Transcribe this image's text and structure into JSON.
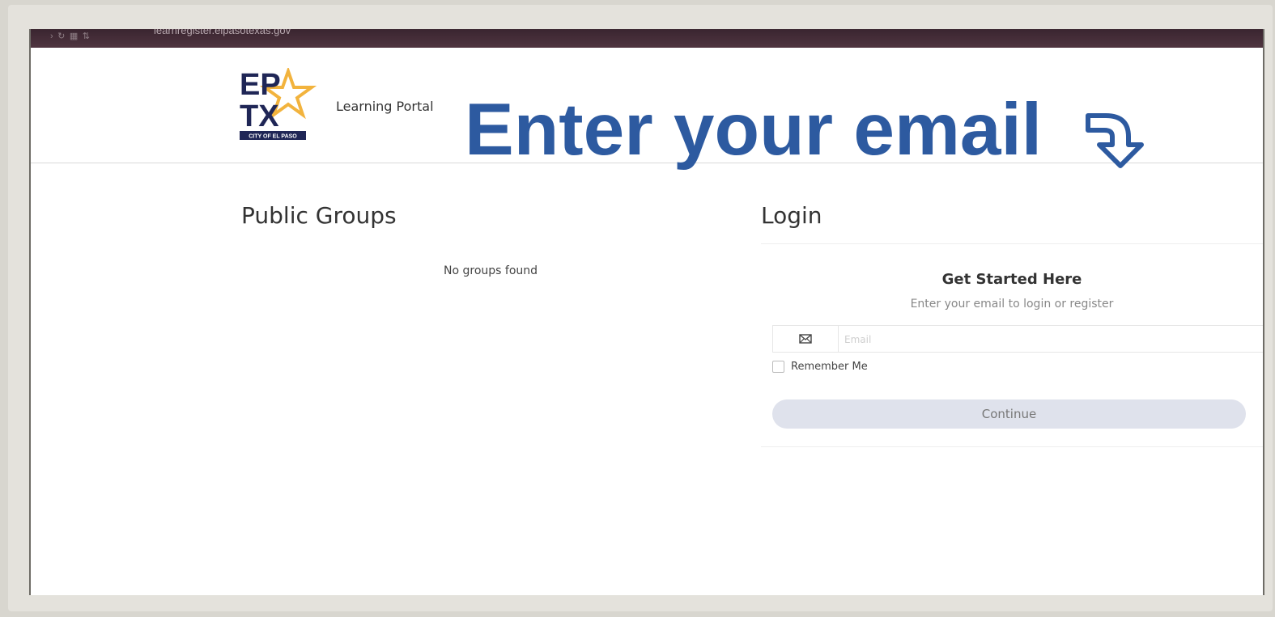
{
  "browser": {
    "url": "learnregister.elpasotexas.gov"
  },
  "logo": {
    "line1": "EP",
    "line2": "TX",
    "tagline": "CITY OF EL PASO"
  },
  "header": {
    "portal_title": "Learning Portal"
  },
  "overlay": {
    "text": "Enter your email"
  },
  "groups": {
    "title": "Public Groups",
    "empty": "No groups found"
  },
  "login": {
    "title": "Login",
    "heading": "Get Started Here",
    "subheading": "Enter your email to login or register",
    "email_placeholder": "Email",
    "remember_label": "Remember Me",
    "continue_label": "Continue"
  },
  "colors": {
    "brand_navy": "#1f2656",
    "brand_gold": "#f2b33d",
    "overlay_blue": "#2d5aa0"
  }
}
